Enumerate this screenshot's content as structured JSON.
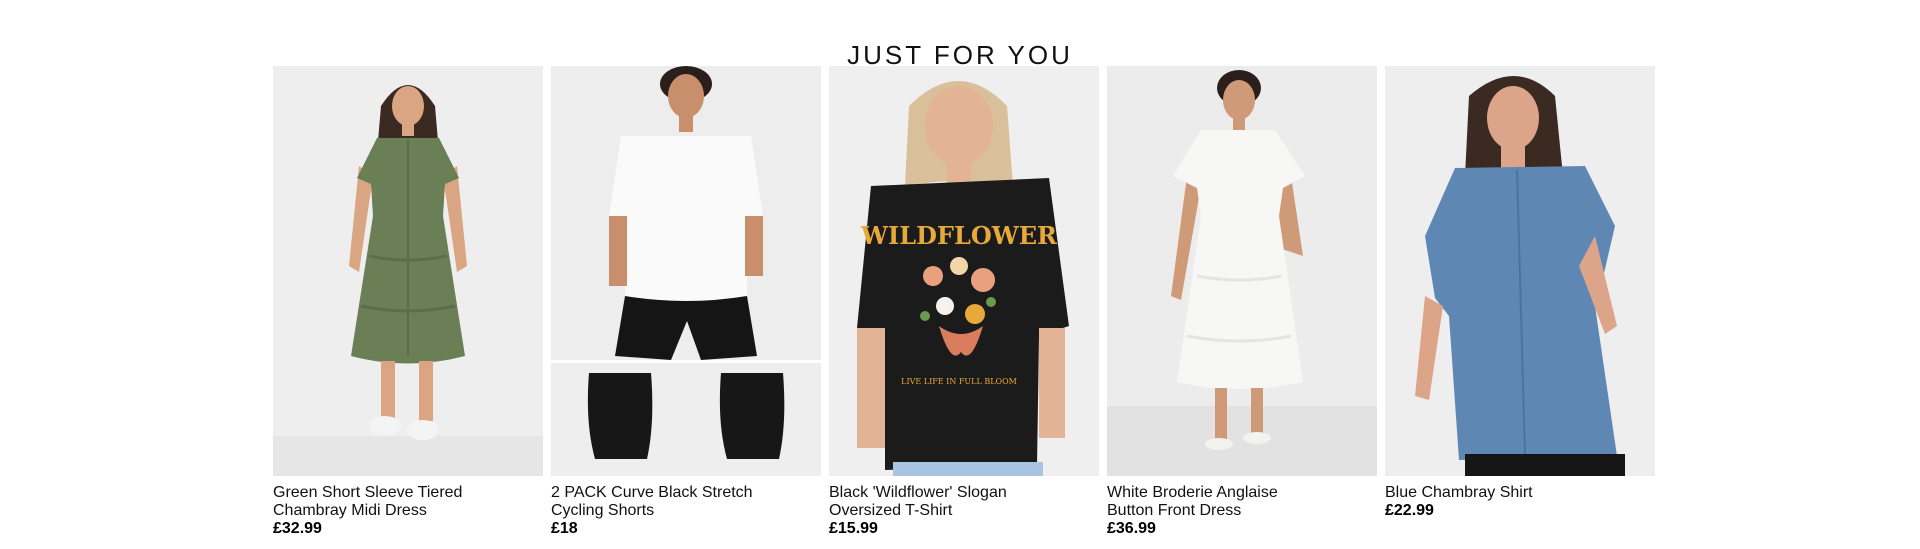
{
  "section": {
    "heading": "JUST FOR YOU"
  },
  "products": [
    {
      "title": "Green Short Sleeve Tiered\nChambray Midi Dress",
      "price": "£32.99",
      "image_icon": "green-dress-photo"
    },
    {
      "title": "2 PACK Curve Black Stretch\nCycling Shorts",
      "price": "£18",
      "image_icon": "cycling-shorts-photo"
    },
    {
      "title": "Black 'Wildflower' Slogan\nOversized T-Shirt",
      "price": "£15.99",
      "image_icon": "wildflower-tshirt-photo",
      "print_text": "WILDFLOWER",
      "print_subtext": "LIVE LIFE IN FULL BLOOM"
    },
    {
      "title": "White Broderie Anglaise\nButton Front Dress",
      "price": "£36.99",
      "image_icon": "white-dress-photo"
    },
    {
      "title": "Blue Chambray Shirt",
      "price": "£22.99",
      "image_icon": "chambray-shirt-photo"
    }
  ],
  "colors": {
    "green_dress": "#6b7f57",
    "black": "#1b1b1b",
    "white_garment": "#f7f7f5",
    "denim": "#5f87b4",
    "skin": "#d9a583",
    "hair_dark": "#3a2a22",
    "hair_blonde": "#d9c09a",
    "print_yellow": "#e6a93a"
  }
}
